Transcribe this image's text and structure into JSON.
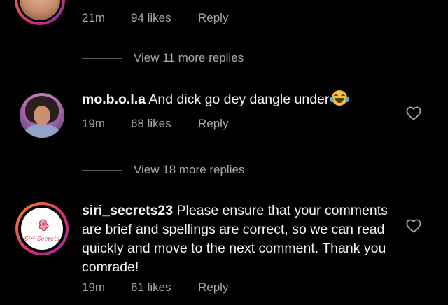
{
  "comments": [
    {
      "time": "21m",
      "likes": "94 likes",
      "reply": "Reply"
    },
    {
      "username": "mo.b.o.l.a",
      "text": " And dick go dey dangle under",
      "emoji": "face-with-tears-of-joy",
      "time": "19m",
      "likes": "68 likes",
      "reply": "Reply"
    },
    {
      "username": "siri_secrets23",
      "text": " Please ensure that your comments are brief and spellings are correct, so we can read quickly and move to the next comment. Thank you comrade!",
      "avatar_logo_text": "Siri Secrets",
      "time": "19m",
      "likes": "61 likes",
      "reply": "Reply"
    }
  ],
  "view_more": [
    {
      "label": "View 11 more replies"
    },
    {
      "label": "View 18 more replies"
    }
  ],
  "icons": {
    "like": "heart-outline-icon",
    "emoji": "face-with-tears-of-joy"
  },
  "colors": {
    "background": "#000000",
    "primary_text": "#f5f5f5",
    "secondary_text": "#a8a8a8",
    "story_ring_start": "#f58529",
    "story_ring_end": "#8134af"
  }
}
